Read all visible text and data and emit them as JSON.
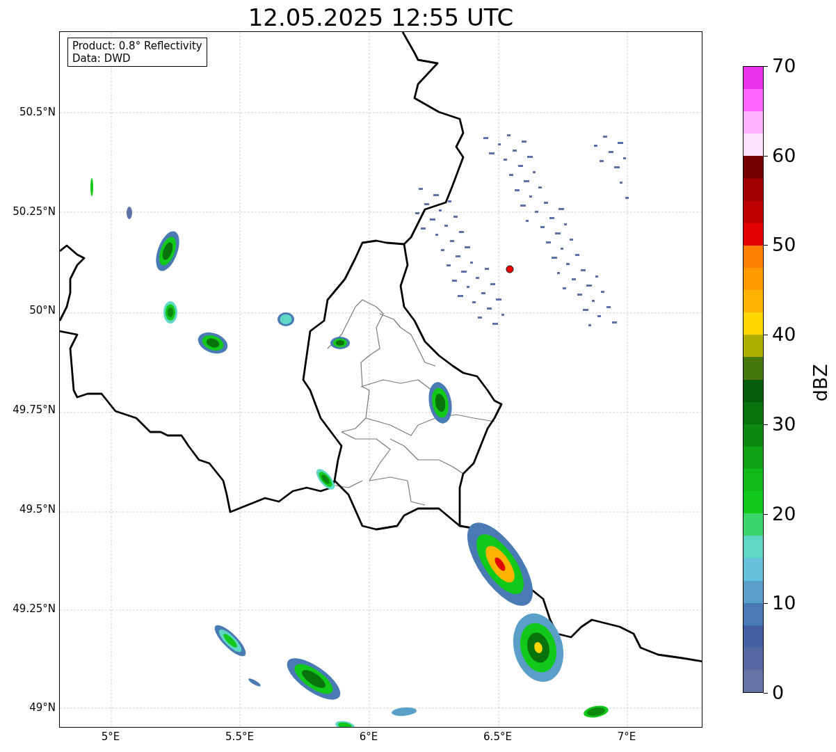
{
  "title": "12.05.2025 12:55 UTC",
  "info_box": [
    "Product: 0.8° Reflectivity",
    "Data: DWD"
  ],
  "y_ticks": [
    "50.5°N",
    "50.25°N",
    "50°N",
    "49.75°N",
    "49.5°N",
    "49.25°N",
    "49°N"
  ],
  "x_ticks": [
    "5°E",
    "5.5°E",
    "6°E",
    "6.5°E",
    "7°E"
  ],
  "colorbar": {
    "label": "dBZ",
    "ticks": [
      "70",
      "60",
      "50",
      "40",
      "30",
      "20",
      "10",
      "0"
    ],
    "segments": [
      {
        "color": "#e932e9"
      },
      {
        "color": "#ff66ff"
      },
      {
        "color": "#ffb3ff"
      },
      {
        "color": "#ffe0ff"
      },
      {
        "color": "#780000"
      },
      {
        "color": "#a00000"
      },
      {
        "color": "#c00000"
      },
      {
        "color": "#e20000"
      },
      {
        "color": "#ff7f00"
      },
      {
        "color": "#ff9a00"
      },
      {
        "color": "#ffb400"
      },
      {
        "color": "#ffd700"
      },
      {
        "color": "#b0b000"
      },
      {
        "color": "#46780c"
      },
      {
        "color": "#065e0a"
      },
      {
        "color": "#08720c"
      },
      {
        "color": "#0c8a10"
      },
      {
        "color": "#0ea214"
      },
      {
        "color": "#10b818"
      },
      {
        "color": "#12c81a"
      },
      {
        "color": "#3cd66c"
      },
      {
        "color": "#5ed8c4"
      },
      {
        "color": "#66c2dc"
      },
      {
        "color": "#5a9fc8"
      },
      {
        "color": "#4a7ab4"
      },
      {
        "color": "#4560a2"
      },
      {
        "color": "#5568a2"
      },
      {
        "color": "#6373a6"
      }
    ]
  }
}
